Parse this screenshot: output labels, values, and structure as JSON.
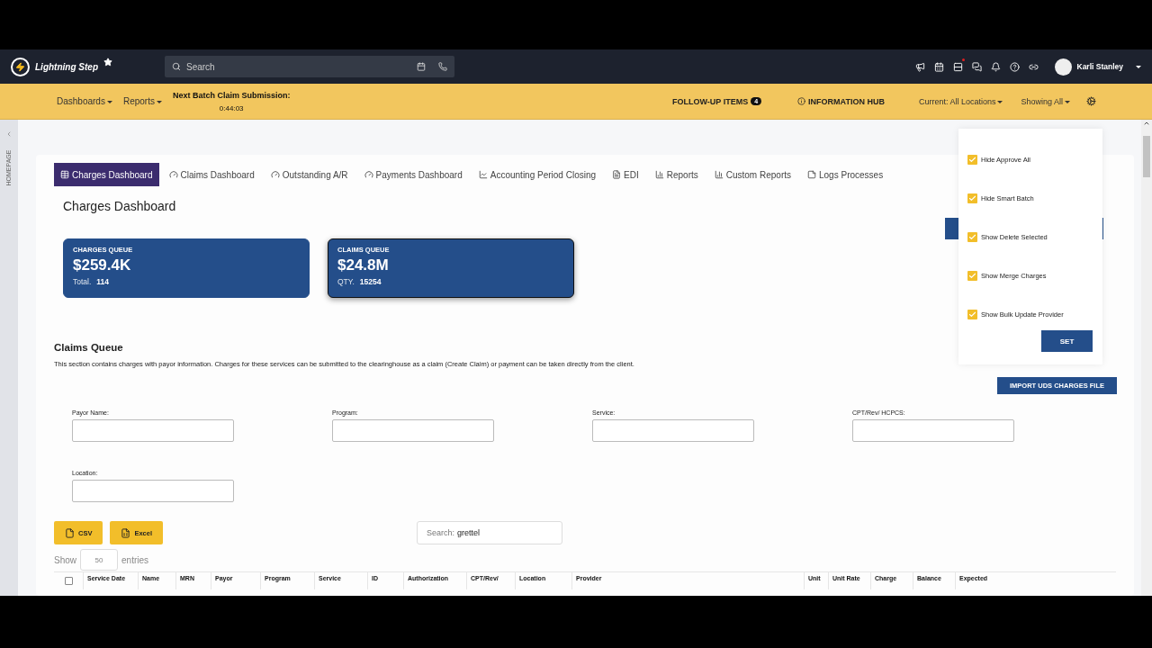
{
  "brand": {
    "name": "Lightning Step"
  },
  "search": {
    "placeholder": "Search"
  },
  "unread_dot": true,
  "user": {
    "name": "Karli Stanley"
  },
  "menu_bar": {
    "menus": [
      {
        "label": "Dashboards"
      },
      {
        "label": "Reports"
      }
    ],
    "batch_title": "Next Batch Claim Submission:",
    "countdown": "0:44:03",
    "follow_up": {
      "label": "FOLLOW-UP ITEMS",
      "count": "4"
    },
    "info_hub": "INFORMATION HUB",
    "location": "Current: All Locations",
    "showing": "Showing All"
  },
  "sidebar": {
    "label": "HOMEPAGE"
  },
  "tabs": [
    {
      "label": "Charges Dashboard",
      "kind": "table",
      "selected": true
    },
    {
      "label": "Claims Dashboard",
      "kind": "gauge",
      "selected": false
    },
    {
      "label": "Outstanding A/R",
      "kind": "gauge",
      "selected": false
    },
    {
      "label": "Payments Dashboard",
      "kind": "gauge",
      "selected": false
    },
    {
      "label": "Accounting Period Closing",
      "kind": "line",
      "selected": false
    },
    {
      "label": "EDI",
      "kind": "file",
      "selected": false
    },
    {
      "label": "Reports",
      "kind": "bar",
      "selected": false
    },
    {
      "label": "Custom Reports",
      "kind": "bar",
      "selected": false
    },
    {
      "label": "Logs Processes",
      "kind": "note",
      "selected": false
    }
  ],
  "page_title": "Charges Dashboard",
  "cards": [
    {
      "title": "CHARGES QUEUE",
      "amount": "$259.4K",
      "caption": "Total.",
      "count": "114",
      "selected": false
    },
    {
      "title": "CLAIMS QUEUE",
      "amount": "$24.8M",
      "caption": "QTY.",
      "count": "15254",
      "selected": true
    }
  ],
  "settings_menu": {
    "options": [
      {
        "label": "Hide Approve All",
        "checked": true
      },
      {
        "label": "Hide Smart Batch",
        "checked": true
      },
      {
        "label": "Show Delete Selected",
        "checked": true
      },
      {
        "label": "Show Merge Charges",
        "checked": true
      },
      {
        "label": "Show Bulk Update Provider",
        "checked": true
      }
    ],
    "button": "SET"
  },
  "section": {
    "title": "Claims Queue",
    "description": "This section contains charges with payor information. Charges for these services can be submitted to the clearinghouse as a claim (Create Claim) or payment can be taken directly from the client."
  },
  "import_button": "IMPORT UDS CHARGES FILE",
  "filters": [
    {
      "label": "Payor Name:"
    },
    {
      "label": "Program:"
    },
    {
      "label": "Service:"
    },
    {
      "label": "CPT/Rev/ HCPCS:"
    },
    {
      "label": "Location:"
    }
  ],
  "export_buttons": [
    {
      "label": "CSV",
      "kind": "csv"
    },
    {
      "label": "Excel",
      "kind": "excel"
    }
  ],
  "table_search": {
    "label": "Search:",
    "value": "grettel"
  },
  "page_length": {
    "before": "Show",
    "value": "50",
    "after": "entries"
  },
  "table": {
    "select_all": false,
    "columns": [
      "Service Date",
      "Name",
      "MRN",
      "Payor",
      "Program",
      "Service",
      "ID",
      "Authorization",
      "CPT/Rev/",
      "Location",
      "Provider",
      "Unit",
      "Unit Rate",
      "Charge",
      "Balance",
      "Expected"
    ]
  }
}
